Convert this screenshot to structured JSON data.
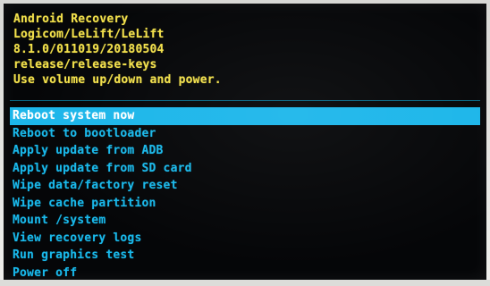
{
  "header": {
    "lines": [
      "Android Recovery",
      "Logicom/LeLift/LeLift",
      "8.1.0/011019/20180504",
      "release/release-keys",
      "Use volume up/down and power."
    ]
  },
  "menu": {
    "selected_index": 0,
    "items": [
      {
        "label": "Reboot system now"
      },
      {
        "label": "Reboot to bootloader"
      },
      {
        "label": "Apply update from ADB"
      },
      {
        "label": "Apply update from SD card"
      },
      {
        "label": "Wipe data/factory reset"
      },
      {
        "label": "Wipe cache partition"
      },
      {
        "label": "Mount /system"
      },
      {
        "label": "View recovery logs"
      },
      {
        "label": "Run graphics test"
      },
      {
        "label": "Power off"
      }
    ]
  },
  "colors": {
    "header_text": "#f2e04b",
    "menu_text": "#19b8ea",
    "selection_background": "#1cb6ea",
    "selection_text": "#ffffff",
    "screen_background": "#050608"
  }
}
